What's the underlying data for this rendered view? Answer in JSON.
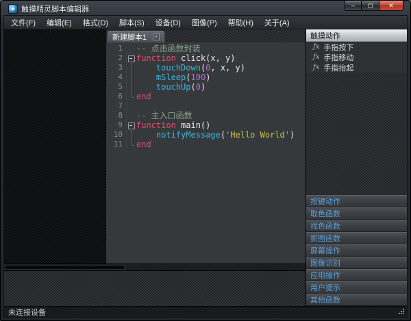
{
  "window": {
    "title": "触摸精灵脚本编辑器",
    "controls": {
      "minimize": "–",
      "maximize": "◻",
      "close": "✕"
    }
  },
  "menu": {
    "items": [
      "文件(F)",
      "编辑(E)",
      "格式(D)",
      "脚本(S)",
      "设备(D)",
      "图像(P)",
      "帮助(H)",
      "关于(A)"
    ]
  },
  "editor": {
    "tab": {
      "label": "新建脚本1",
      "close": "×"
    },
    "code": {
      "lines": [
        {
          "n": "1",
          "fold": "",
          "seg": [
            [
              "comment",
              "-- 点击函数封装"
            ]
          ]
        },
        {
          "n": "2",
          "fold": "box",
          "seg": [
            [
              "keyword",
              "function"
            ],
            [
              "plain",
              " click(x, y)"
            ]
          ]
        },
        {
          "n": "3",
          "fold": "line",
          "seg": [
            [
              "plain",
              "    "
            ],
            [
              "builtin",
              "touchDown"
            ],
            [
              "plain",
              "("
            ],
            [
              "number",
              "0"
            ],
            [
              "plain",
              ", x, y)"
            ]
          ]
        },
        {
          "n": "4",
          "fold": "line",
          "seg": [
            [
              "plain",
              "    "
            ],
            [
              "builtin",
              "mSleep"
            ],
            [
              "plain",
              "("
            ],
            [
              "number",
              "100"
            ],
            [
              "plain",
              ")"
            ]
          ]
        },
        {
          "n": "5",
          "fold": "line",
          "seg": [
            [
              "plain",
              "    "
            ],
            [
              "builtin",
              "touchUp"
            ],
            [
              "plain",
              "("
            ],
            [
              "number",
              "0"
            ],
            [
              "plain",
              ")"
            ]
          ]
        },
        {
          "n": "6",
          "fold": "end",
          "seg": [
            [
              "keyword",
              "end"
            ]
          ]
        },
        {
          "n": "7",
          "fold": "",
          "seg": []
        },
        {
          "n": "8",
          "fold": "",
          "seg": [
            [
              "comment",
              "-- 主入口函数"
            ]
          ]
        },
        {
          "n": "9",
          "fold": "box",
          "seg": [
            [
              "keyword",
              "function"
            ],
            [
              "plain",
              " main()"
            ]
          ]
        },
        {
          "n": "10",
          "fold": "line",
          "seg": [
            [
              "plain",
              "    "
            ],
            [
              "builtin",
              "notifyMessage"
            ],
            [
              "plain",
              "("
            ],
            [
              "string",
              "'Hello World'"
            ],
            [
              "plain",
              ")"
            ]
          ]
        },
        {
          "n": "11",
          "fold": "end",
          "seg": [
            [
              "keyword",
              "end"
            ]
          ]
        }
      ]
    }
  },
  "sidebar": {
    "active_panel": "触摸动作",
    "function_items": [
      {
        "icon": "ƒx",
        "label": "手指按下"
      },
      {
        "icon": "ƒx",
        "label": "手指移动"
      },
      {
        "icon": "ƒx",
        "label": "手指抬起"
      }
    ],
    "collapsed_panels": [
      "按键动作",
      "取色函数",
      "找色函数",
      "抓图函数",
      "屏幕操作",
      "图像识别",
      "应用操作",
      "用户提示",
      "其他函数"
    ]
  },
  "statusbar": {
    "text": "未连接设备"
  },
  "colors": {
    "keyword": "#e04a6a",
    "builtin": "#3fb3dc",
    "number": "#b06cc9",
    "string": "#cdc542",
    "comment": "#8aa186",
    "plain": "#e8e8e8",
    "panel_link": "#5e9fd8",
    "close_button": "#c8402e"
  }
}
